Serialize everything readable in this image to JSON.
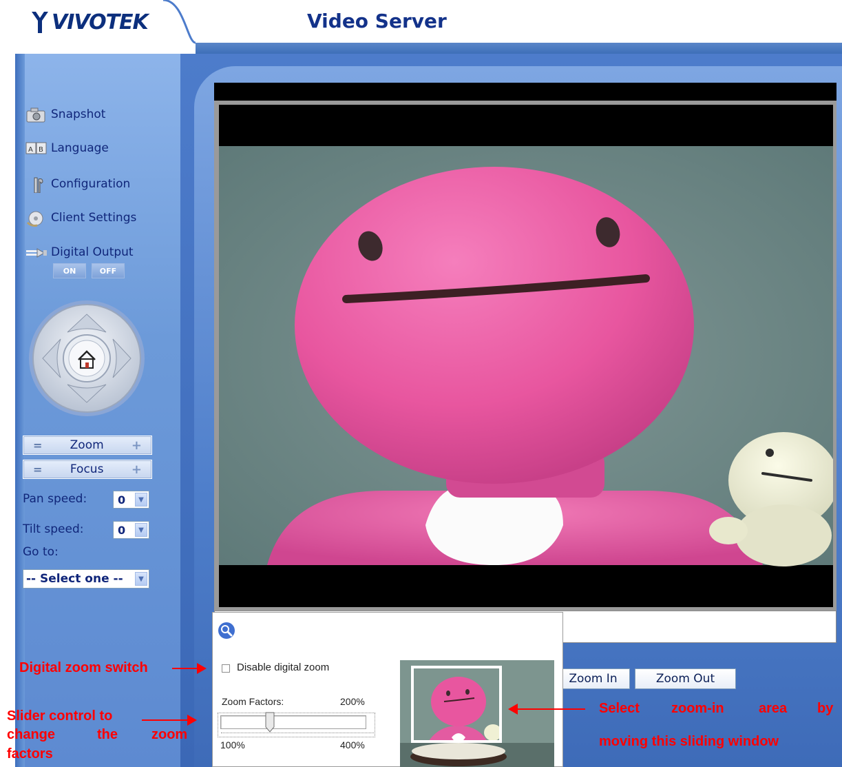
{
  "header": {
    "logo_text": "VIVOTEK",
    "title": "Video Server"
  },
  "sidebar": {
    "items": [
      {
        "label": "Snapshot",
        "icon": "camera-icon"
      },
      {
        "label": "Language",
        "icon": "language-icon"
      },
      {
        "label": "Configuration",
        "icon": "tools-icon"
      },
      {
        "label": "Client Settings",
        "icon": "disc-icon"
      },
      {
        "label": "Digital Output",
        "icon": "plug-icon"
      }
    ],
    "digital_output": {
      "on_label": "ON",
      "off_label": "OFF"
    },
    "zoom_label": "Zoom",
    "focus_label": "Focus",
    "pan_speed_label": "Pan speed:",
    "pan_speed_value": "0",
    "tilt_speed_label": "Tilt speed:",
    "tilt_speed_value": "0",
    "goto_label": "Go to:",
    "goto_value": "-- Select one --"
  },
  "controls": {
    "zoom_in_label": "Zoom In",
    "zoom_out_label": "Zoom Out"
  },
  "zoom_panel": {
    "disable_label": "Disable digital zoom",
    "disable_checked": false,
    "factors_label": "Zoom Factors:",
    "factor_value": "200%",
    "min_label": "100%",
    "max_label": "400%",
    "slider_fraction": 0.33
  },
  "annotations": {
    "switch": "Digital zoom switch",
    "slider_line1": "Slider control to",
    "slider_line2a": "change",
    "slider_line2b": "the",
    "slider_line2c": "zoom",
    "slider_line3": "factors",
    "select_line1a": "Select",
    "select_line1b": "zoom-in",
    "select_line1c": "area",
    "select_line1d": "by",
    "select_line2": "moving this sliding window"
  },
  "colors": {
    "brand": "#13328a",
    "annotation": "#ff0000",
    "doll_pink": "#e85ea4"
  }
}
